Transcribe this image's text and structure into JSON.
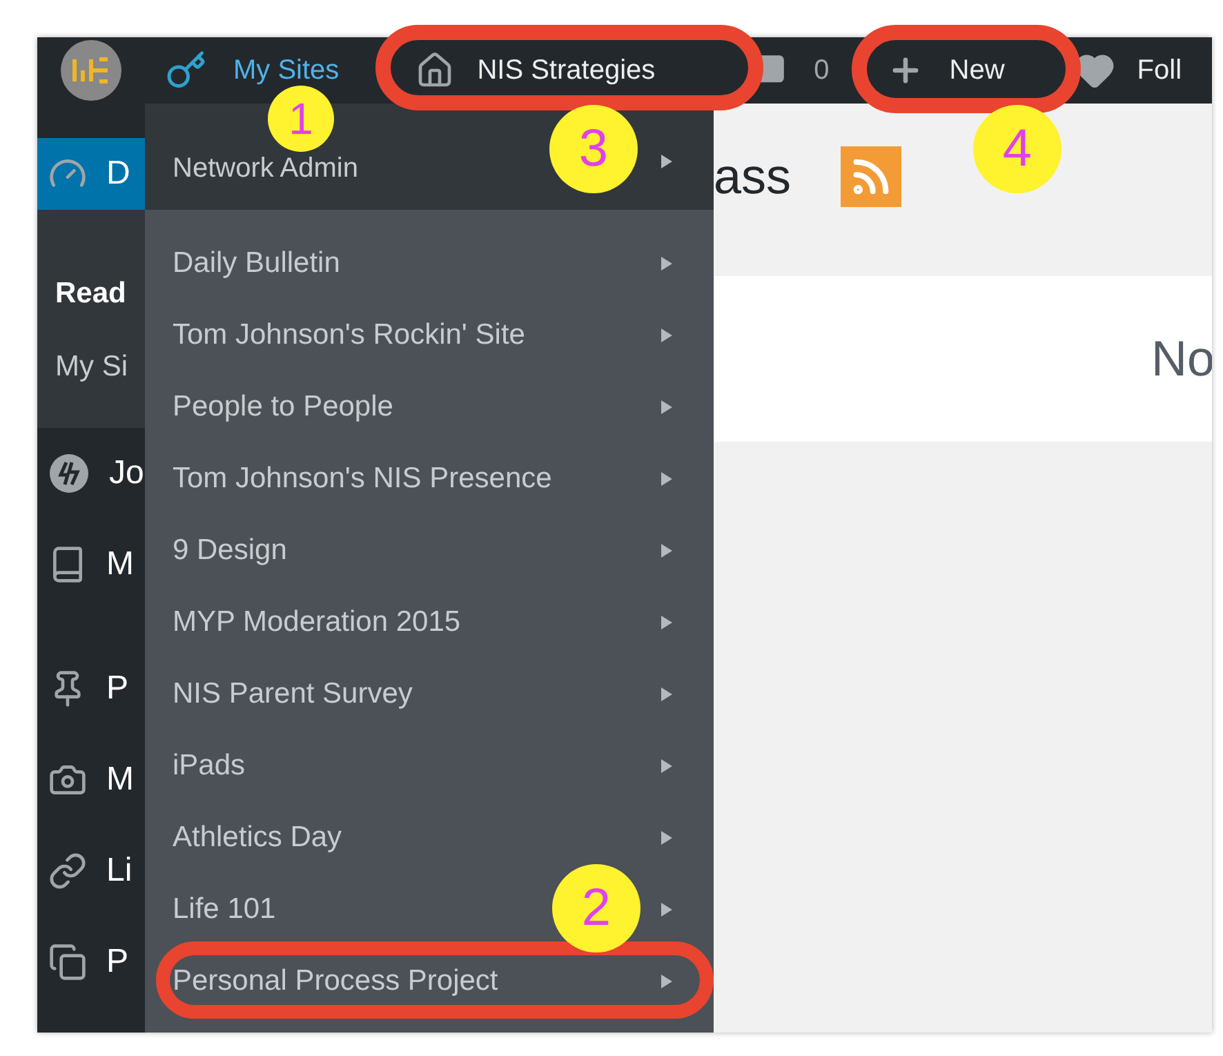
{
  "admin_bar": {
    "my_sites": "My Sites",
    "site": "NIS Strategies",
    "comments": "0",
    "new": "New",
    "follow": "Foll"
  },
  "sidebar": {
    "items": [
      {
        "label": "D",
        "selected": true,
        "children": [
          {
            "label": "Read",
            "selected": true
          },
          {
            "label": "My Si",
            "selected": false
          }
        ]
      },
      {
        "label": "Jo",
        "selected": false
      },
      {
        "label": "M",
        "selected": false
      },
      {
        "label": "P",
        "selected": false
      },
      {
        "label": "M",
        "selected": false
      },
      {
        "label": "Li",
        "selected": false
      },
      {
        "label": "P",
        "selected": false
      }
    ]
  },
  "sites_menu": {
    "network_admin": "Network Admin",
    "sites": [
      "Daily Bulletin",
      "Tom Johnson's Rockin' Site",
      "People to People",
      "Tom Johnson's NIS Presence",
      "9 Design",
      "MYP Moderation 2015",
      "NIS Parent Survey",
      "iPads",
      "Athletics Day",
      "Life 101",
      "Personal Process Project"
    ]
  },
  "main": {
    "heading": "ass",
    "panel_text": "No"
  },
  "annotations": {
    "markers": [
      "1",
      "3",
      "4",
      "2"
    ]
  }
}
